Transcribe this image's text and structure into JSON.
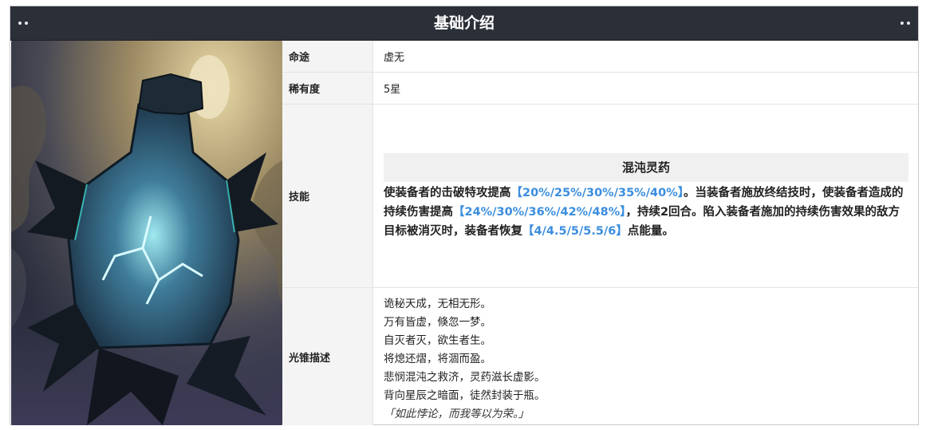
{
  "header": {
    "title": "基础介绍"
  },
  "rows": {
    "path": {
      "label": "命途",
      "value": "虚无"
    },
    "rarity": {
      "label": "稀有度",
      "value": "5星"
    },
    "skill": {
      "label": "技能",
      "name": "混沌灵药",
      "desc_parts": [
        "使装备者的击破特攻提高",
        "【20%/25%/30%/35%/40%】",
        "。当装备者施放终结技时，使装备者造成的持续伤害提高",
        "【24%/30%/36%/42%/48%】",
        "，持续2回合。陷入装备者施加的持续伤害效果的敌方目标被消灭时，装备者恢复",
        "【4/4.5/5/5.5/6】",
        "点能量。"
      ]
    },
    "description": {
      "label": "光锥描述",
      "lines": [
        "诡秘天成，无相无形。",
        "万有皆虚，倏忽一梦。",
        "自灭者灭，欲生者生。",
        "将熄还熠，将涸而盈。",
        "悲悯混沌之救济，灵药滋长虚影。",
        "背向星辰之暗面，徒然封装于瓶。",
        "「如此悖论，而我等以为荣。」"
      ]
    }
  },
  "art": {
    "icon": "light-cone-artwork",
    "accent": "#3fd6d0",
    "background": "#2a2d3c"
  }
}
